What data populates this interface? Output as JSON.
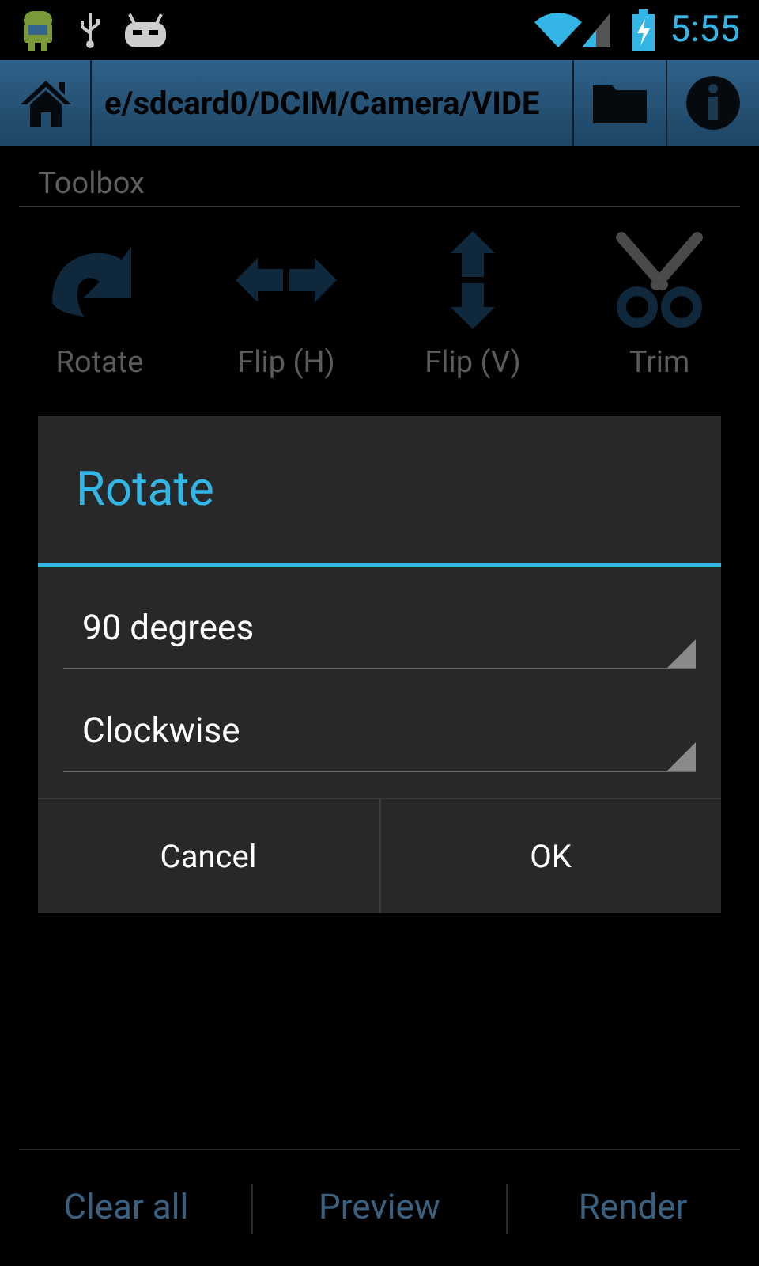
{
  "status_bar": {
    "time": "5:55"
  },
  "toolbar": {
    "path": "e/sdcard0/DCIM/Camera/VIDE"
  },
  "toolbox": {
    "title": "Toolbox",
    "tools": [
      {
        "kind": "rotate",
        "label": "Rotate"
      },
      {
        "kind": "flip_h",
        "label": "Flip (H)"
      },
      {
        "kind": "flip_v",
        "label": "Flip (V)"
      },
      {
        "kind": "trim",
        "label": "Trim"
      }
    ]
  },
  "dialog": {
    "title": "Rotate",
    "spinners": [
      {
        "value": "90 degrees"
      },
      {
        "value": "Clockwise"
      }
    ],
    "buttons": [
      "Cancel",
      "OK"
    ]
  },
  "bottom_bar": {
    "buttons": [
      "Clear all",
      "Preview",
      "Render"
    ]
  }
}
